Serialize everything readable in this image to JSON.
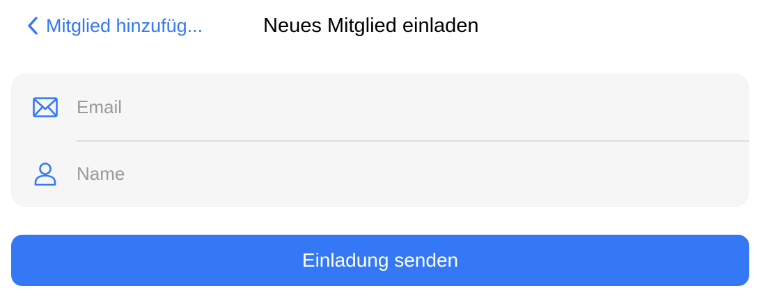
{
  "nav": {
    "back_label": "Mitglied hinzufüg...",
    "back_icon": "chevron-left-icon",
    "title": "Neues Mitglied einladen"
  },
  "form": {
    "email": {
      "icon": "envelope-icon",
      "placeholder": "Email",
      "value": ""
    },
    "name": {
      "icon": "person-icon",
      "placeholder": "Name",
      "value": ""
    }
  },
  "actions": {
    "send_label": "Einladung senden"
  },
  "colors": {
    "accent": "#3478f6",
    "card_background": "#f6f6f6",
    "placeholder": "#9a9a9e",
    "divider": "#dedede"
  }
}
